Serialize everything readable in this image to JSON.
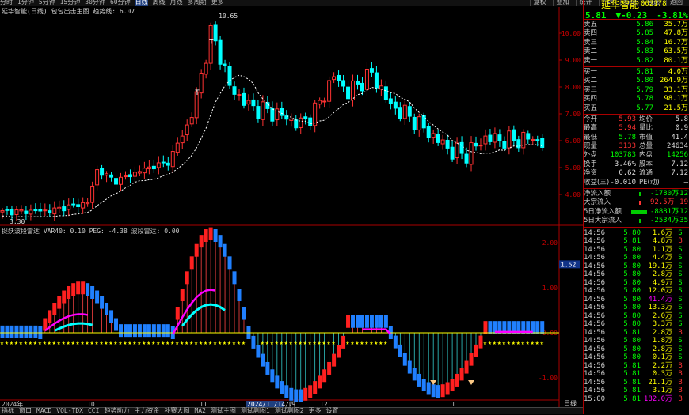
{
  "top": {
    "periods": [
      "分时",
      "1分钟",
      "5分钟",
      "15分钟",
      "30分钟",
      "60分钟",
      "日线",
      "周线",
      "月线",
      "多周期",
      "更多"
    ],
    "active_period": "日线",
    "tools": [
      "复权",
      "叠加",
      "统计",
      "F10",
      "标记",
      "自选",
      "返回"
    ]
  },
  "main_chart": {
    "info": "延华智能(日线) 包包出击主图 趋势线: 6.07",
    "price_ticks": [
      "10.00",
      "9.00",
      "8.00",
      "7.00",
      "6.00",
      "5.00",
      "4.00"
    ],
    "high_label": "10.65",
    "low_label": "3.30",
    "t_labels": [
      "T",
      "T"
    ]
  },
  "sub_chart": {
    "info": "捉妖波段雷达 VAR40: 0.10 PEG: -4.38 波段雷达: 0.00",
    "ticks": [
      "2.00",
      "1.00",
      "0.00",
      "-1.00",
      "-2.00"
    ],
    "cursor_value": "1.52"
  },
  "date_axis": [
    "2024年",
    "10",
    "11",
    "2024/11/14/四",
    "12",
    "1"
  ],
  "stock": {
    "name": "延华智能",
    "code": "002178",
    "price": "5.81",
    "change": "▼-0.23",
    "pct": "-3.81%"
  },
  "orderbook": {
    "asks": [
      {
        "label": "卖五",
        "price": "5.86",
        "vol": "35.7万"
      },
      {
        "label": "卖四",
        "price": "5.85",
        "vol": "47.8万"
      },
      {
        "label": "卖三",
        "price": "5.84",
        "vol": "16.7万"
      },
      {
        "label": "卖二",
        "price": "5.83",
        "vol": "63.5万"
      },
      {
        "label": "卖一",
        "price": "5.82",
        "vol": "80.1万"
      }
    ],
    "bids": [
      {
        "label": "买一",
        "price": "5.81",
        "vol": "4.0万"
      },
      {
        "label": "买二",
        "price": "5.80",
        "vol": "264.9万"
      },
      {
        "label": "买三",
        "price": "5.79",
        "vol": "33.1万"
      },
      {
        "label": "买四",
        "price": "5.78",
        "vol": "98.1万"
      },
      {
        "label": "买五",
        "price": "5.77",
        "vol": "21.5万"
      }
    ]
  },
  "stats": [
    {
      "l1": "今开",
      "v1": "5.93",
      "l2": "均价",
      "v2": "5.8"
    },
    {
      "l1": "最高",
      "v1": "5.94",
      "l2": "量比",
      "v2": "0.9"
    },
    {
      "l1": "最低",
      "v1": "5.78",
      "l2": "市值",
      "v2": "41.4"
    },
    {
      "l1": "现量",
      "v1": "3133",
      "l2": "总量",
      "v2": "24634"
    },
    {
      "l1": "外盘",
      "v1": "103783",
      "l2": "内盘",
      "v2": "14256"
    },
    {
      "l1": "换手",
      "v1": "3.46%",
      "l2": "股本",
      "v2": "7.12"
    },
    {
      "l1": "净资",
      "v1": "0.62",
      "l2": "流通",
      "v2": "7.12"
    },
    {
      "l1": "收益(三)",
      "v1": "-0.010",
      "l2": "PE(动)",
      "v2": "—"
    }
  ],
  "flows": [
    {
      "label": "净流入额",
      "v": "-1780万",
      "v2": "-12"
    },
    {
      "label": "大宗流入",
      "v": "92.5万",
      "v2": "19"
    },
    {
      "label": "5日净流入额",
      "v": "-8881万",
      "v2": "-12"
    },
    {
      "label": "5日大宗流入",
      "v": "-2534万",
      "v2": "-35"
    }
  ],
  "ticks": [
    {
      "t": "14:56",
      "p": "5.80",
      "v": "1.6万",
      "s": "S"
    },
    {
      "t": "14:56",
      "p": "5.81",
      "v": "4.8万",
      "s": "B"
    },
    {
      "t": "14:56",
      "p": "5.80",
      "v": "1.1万",
      "s": "S"
    },
    {
      "t": "14:56",
      "p": "5.80",
      "v": "4.4万",
      "s": "S"
    },
    {
      "t": "14:56",
      "p": "5.80",
      "v": "19.1万",
      "s": "S"
    },
    {
      "t": "14:56",
      "p": "5.80",
      "v": "2.8万",
      "s": "S"
    },
    {
      "t": "14:56",
      "p": "5.80",
      "v": "4.9万",
      "s": "S"
    },
    {
      "t": "14:56",
      "p": "5.80",
      "v": "12.0万",
      "s": "S"
    },
    {
      "t": "14:56",
      "p": "5.80",
      "v": "41.4万",
      "s": "S"
    },
    {
      "t": "14:56",
      "p": "5.80",
      "v": "13.3万",
      "s": "S"
    },
    {
      "t": "14:56",
      "p": "5.80",
      "v": "2.0万",
      "s": "S"
    },
    {
      "t": "14:56",
      "p": "5.80",
      "v": "3.3万",
      "s": "S"
    },
    {
      "t": "14:56",
      "p": "5.81",
      "v": "2.8万",
      "s": "B"
    },
    {
      "t": "14:56",
      "p": "5.80",
      "v": "1.8万",
      "s": "S"
    },
    {
      "t": "14:56",
      "p": "5.80",
      "v": "2.8万",
      "s": "S"
    },
    {
      "t": "14:56",
      "p": "5.80",
      "v": "0.1万",
      "s": "S"
    },
    {
      "t": "14:56",
      "p": "5.81",
      "v": "2.2万",
      "s": "B"
    },
    {
      "t": "14:56",
      "p": "5.81",
      "v": "0.3万",
      "s": "B"
    },
    {
      "t": "14:56",
      "p": "5.81",
      "v": "21.1万",
      "s": "B"
    },
    {
      "t": "14:56",
      "p": "5.81",
      "v": "3.1万",
      "s": "B"
    },
    {
      "t": "15:00",
      "p": "5.81",
      "v": "182.0万",
      "s": "B"
    }
  ],
  "bottom_tabs": [
    "指标",
    "窗口",
    "MACD",
    "VOL-TDX",
    "CCI",
    "趋势动力",
    "主力资金",
    "补赛大图",
    "MA2",
    "测试主图",
    "测试副图1",
    "测试副图2",
    "更多",
    "设置"
  ],
  "right_tab": "日线",
  "colors": {
    "up": "#ff3232",
    "down": "#00ffff",
    "bg": "#000000",
    "frame": "#aa0000"
  }
}
